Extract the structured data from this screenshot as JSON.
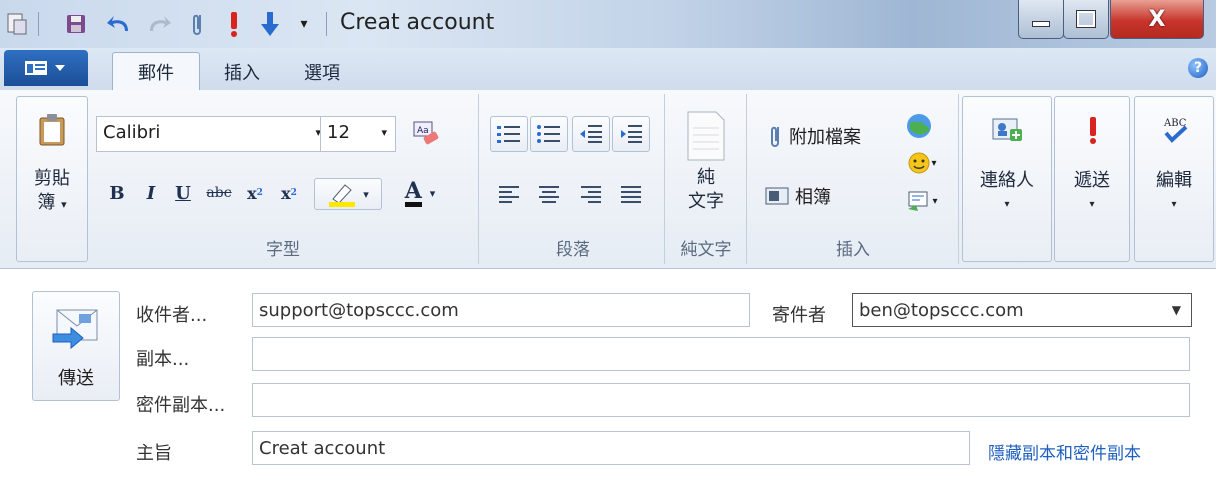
{
  "window": {
    "title": "Creat account"
  },
  "tabs": [
    {
      "label": "郵件"
    },
    {
      "label": "插入"
    },
    {
      "label": "選項"
    }
  ],
  "ribbon": {
    "clipboard": {
      "label_line1": "剪貼",
      "label_line2": "簿"
    },
    "font": {
      "family": "Calibri",
      "size": "12",
      "group_label": "字型"
    },
    "paragraph": {
      "group_label": "段落"
    },
    "plaintext": {
      "label_line1": "純",
      "label_line2": "文字",
      "group_label": "純文字"
    },
    "insert": {
      "attach_label": "附加檔案",
      "album_label": "相簿",
      "group_label": "插入"
    },
    "contacts_label": "連絡人",
    "deliver_label": "遞送",
    "edit_label": "編輯"
  },
  "form": {
    "send_label": "傳送",
    "to_label": "收件者...",
    "to_value": "support@topsccc.com",
    "from_label": "寄件者",
    "from_value": "ben@topsccc.com",
    "cc_label": "副本...",
    "cc_value": "",
    "bcc_label": "密件副本...",
    "bcc_value": "",
    "subject_label": "主旨",
    "subject_value": "Creat account",
    "hide_cc_bcc_link": "隱藏副本和密件副本"
  },
  "colors": {
    "accent": "#1b4f98",
    "link": "#1f5fbf",
    "close": "#c8352c",
    "highlight": "#ffe800"
  }
}
